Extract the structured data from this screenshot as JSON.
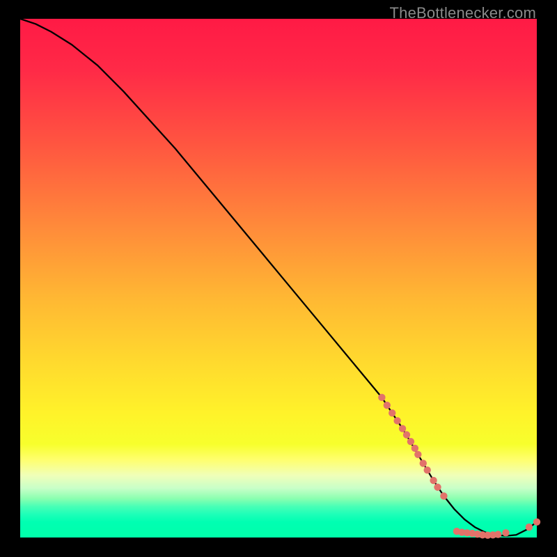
{
  "watermark": "TheBottlenecker.com",
  "colors": {
    "background": "#000000",
    "marker": "#e2736a",
    "curve": "#000000"
  },
  "chart_data": {
    "type": "line",
    "title": "",
    "xlabel": "",
    "ylabel": "",
    "xlim": [
      0,
      100
    ],
    "ylim": [
      0,
      100
    ],
    "grid": false,
    "legend": false,
    "series": [
      {
        "name": "bottleneck-curve",
        "x": [
          0,
          3,
          6,
          10,
          15,
          20,
          30,
          40,
          50,
          60,
          70,
          74,
          77,
          80,
          82,
          84,
          86,
          88,
          90,
          92,
          94,
          96,
          98,
          100
        ],
        "y": [
          100,
          99,
          97.5,
          95,
          91,
          86,
          75,
          63,
          51,
          39,
          27,
          21,
          16,
          11,
          8,
          5.5,
          3.5,
          2,
          1,
          0.5,
          0.3,
          0.5,
          1.5,
          3
        ]
      }
    ],
    "markers": [
      {
        "x": 70.0,
        "y": 27.0
      },
      {
        "x": 71.0,
        "y": 25.5
      },
      {
        "x": 72.0,
        "y": 24.0
      },
      {
        "x": 73.0,
        "y": 22.5
      },
      {
        "x": 74.0,
        "y": 21.0
      },
      {
        "x": 74.8,
        "y": 19.8
      },
      {
        "x": 75.6,
        "y": 18.5
      },
      {
        "x": 76.4,
        "y": 17.2
      },
      {
        "x": 77.0,
        "y": 16.0
      },
      {
        "x": 78.0,
        "y": 14.3
      },
      {
        "x": 78.8,
        "y": 13.0
      },
      {
        "x": 80.0,
        "y": 11.0
      },
      {
        "x": 80.8,
        "y": 9.7
      },
      {
        "x": 82.0,
        "y": 8.0
      },
      {
        "x": 84.5,
        "y": 1.2
      },
      {
        "x": 85.5,
        "y": 1.0
      },
      {
        "x": 86.5,
        "y": 0.9
      },
      {
        "x": 87.5,
        "y": 0.8
      },
      {
        "x": 88.5,
        "y": 0.65
      },
      {
        "x": 89.5,
        "y": 0.5
      },
      {
        "x": 90.5,
        "y": 0.45
      },
      {
        "x": 91.5,
        "y": 0.5
      },
      {
        "x": 92.5,
        "y": 0.6
      },
      {
        "x": 94.0,
        "y": 0.9
      },
      {
        "x": 98.5,
        "y": 2.0
      },
      {
        "x": 100.0,
        "y": 3.0
      }
    ]
  }
}
